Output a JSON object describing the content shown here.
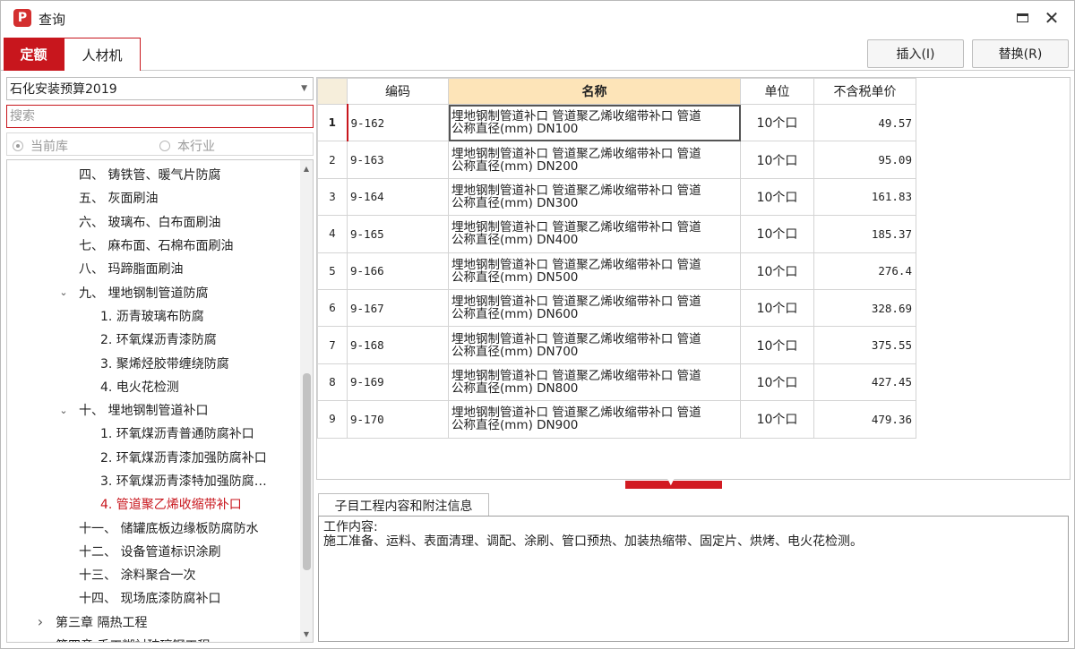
{
  "window": {
    "title": "查询",
    "app_icon": "P"
  },
  "tabs": [
    {
      "label": "定额",
      "active": true
    },
    {
      "label": "人材机",
      "active": false
    }
  ],
  "actions": {
    "insert_label": "插入(I)",
    "replace_label": "替换(R)"
  },
  "left": {
    "library_select": "石化安装预算2019",
    "search_placeholder": "搜索",
    "radios": [
      {
        "label": "当前库",
        "checked": true
      },
      {
        "label": "本行业",
        "checked": false
      }
    ],
    "tree": [
      {
        "label": "四、 铸铁管、暖气片防腐",
        "indent": 80,
        "chevron": ""
      },
      {
        "label": "五、 灰面刷油",
        "indent": 80,
        "chevron": ""
      },
      {
        "label": "六、 玻璃布、白布面刷油",
        "indent": 80,
        "chevron": ""
      },
      {
        "label": "七、 麻布面、石棉布面刷油",
        "indent": 80,
        "chevron": ""
      },
      {
        "label": "八、 玛蹄脂面刷油",
        "indent": 80,
        "chevron": ""
      },
      {
        "label": "九、 埋地钢制管道防腐",
        "indent": 80,
        "chevron": "expanded"
      },
      {
        "label": "1. 沥青玻璃布防腐",
        "indent": 104,
        "chevron": ""
      },
      {
        "label": "2. 环氧煤沥青漆防腐",
        "indent": 104,
        "chevron": ""
      },
      {
        "label": "3. 聚烯烃胶带缠绕防腐",
        "indent": 104,
        "chevron": ""
      },
      {
        "label": "4. 电火花检测",
        "indent": 104,
        "chevron": ""
      },
      {
        "label": "十、 埋地钢制管道补口",
        "indent": 80,
        "chevron": "expanded"
      },
      {
        "label": "1. 环氧煤沥青普通防腐补口",
        "indent": 104,
        "chevron": ""
      },
      {
        "label": "2. 环氧煤沥青漆加强防腐补口",
        "indent": 104,
        "chevron": ""
      },
      {
        "label": "3. 环氧煤沥青漆特加强防腐…",
        "indent": 104,
        "chevron": ""
      },
      {
        "label": "4. 管道聚乙烯收缩带补口",
        "indent": 104,
        "chevron": "",
        "selected": true
      },
      {
        "label": "十一、 储罐底板边缘板防腐防水",
        "indent": 80,
        "chevron": ""
      },
      {
        "label": "十二、 设备管道标识涂刷",
        "indent": 80,
        "chevron": ""
      },
      {
        "label": "十三、 涂料聚合一次",
        "indent": 80,
        "chevron": ""
      },
      {
        "label": "十四、 现场底漆防腐补口",
        "indent": 80,
        "chevron": ""
      },
      {
        "label": "第三章 隔热工程",
        "indent": 54,
        "chevron": "collapsed"
      },
      {
        "label": "第四章 手工糊衬玻璃钢工程",
        "indent": 54,
        "chevron": "collapsed"
      }
    ]
  },
  "grid": {
    "headers": {
      "code": "编码",
      "name": "名称",
      "unit": "单位",
      "price": "不含税单价"
    },
    "rows": [
      {
        "idx": "1",
        "code": "9-162",
        "name1": "埋地钢制管道补口 管道聚乙烯收缩带补口 管道",
        "name2": "公称直径(mm) DN100",
        "unit": "10个口",
        "price": "49.57"
      },
      {
        "idx": "2",
        "code": "9-163",
        "name1": "埋地钢制管道补口 管道聚乙烯收缩带补口 管道",
        "name2": "公称直径(mm) DN200",
        "unit": "10个口",
        "price": "95.09"
      },
      {
        "idx": "3",
        "code": "9-164",
        "name1": "埋地钢制管道补口 管道聚乙烯收缩带补口 管道",
        "name2": "公称直径(mm) DN300",
        "unit": "10个口",
        "price": "161.83"
      },
      {
        "idx": "4",
        "code": "9-165",
        "name1": "埋地钢制管道补口 管道聚乙烯收缩带补口 管道",
        "name2": "公称直径(mm) DN400",
        "unit": "10个口",
        "price": "185.37"
      },
      {
        "idx": "5",
        "code": "9-166",
        "name1": "埋地钢制管道补口 管道聚乙烯收缩带补口 管道",
        "name2": "公称直径(mm) DN500",
        "unit": "10个口",
        "price": "276.4"
      },
      {
        "idx": "6",
        "code": "9-167",
        "name1": "埋地钢制管道补口 管道聚乙烯收缩带补口 管道",
        "name2": "公称直径(mm) DN600",
        "unit": "10个口",
        "price": "328.69"
      },
      {
        "idx": "7",
        "code": "9-168",
        "name1": "埋地钢制管道补口 管道聚乙烯收缩带补口 管道",
        "name2": "公称直径(mm) DN700",
        "unit": "10个口",
        "price": "375.55"
      },
      {
        "idx": "8",
        "code": "9-169",
        "name1": "埋地钢制管道补口 管道聚乙烯收缩带补口 管道",
        "name2": "公称直径(mm) DN800",
        "unit": "10个口",
        "price": "427.45"
      },
      {
        "idx": "9",
        "code": "9-170",
        "name1": "埋地钢制管道补口 管道聚乙烯收缩带补口 管道",
        "name2": "公称直径(mm) DN900",
        "unit": "10个口",
        "price": "479.36"
      }
    ],
    "selected_row": 0
  },
  "info": {
    "tab_label": "子目工程内容和附注信息",
    "heading": "工作内容:",
    "content": "施工准备、运料、表面清理、调配、涂刷、管口预热、加装热缩带、固定片、烘烤、电火花检测。"
  },
  "colors": {
    "accent": "#c8161d",
    "name_header": "#fde4b8"
  }
}
